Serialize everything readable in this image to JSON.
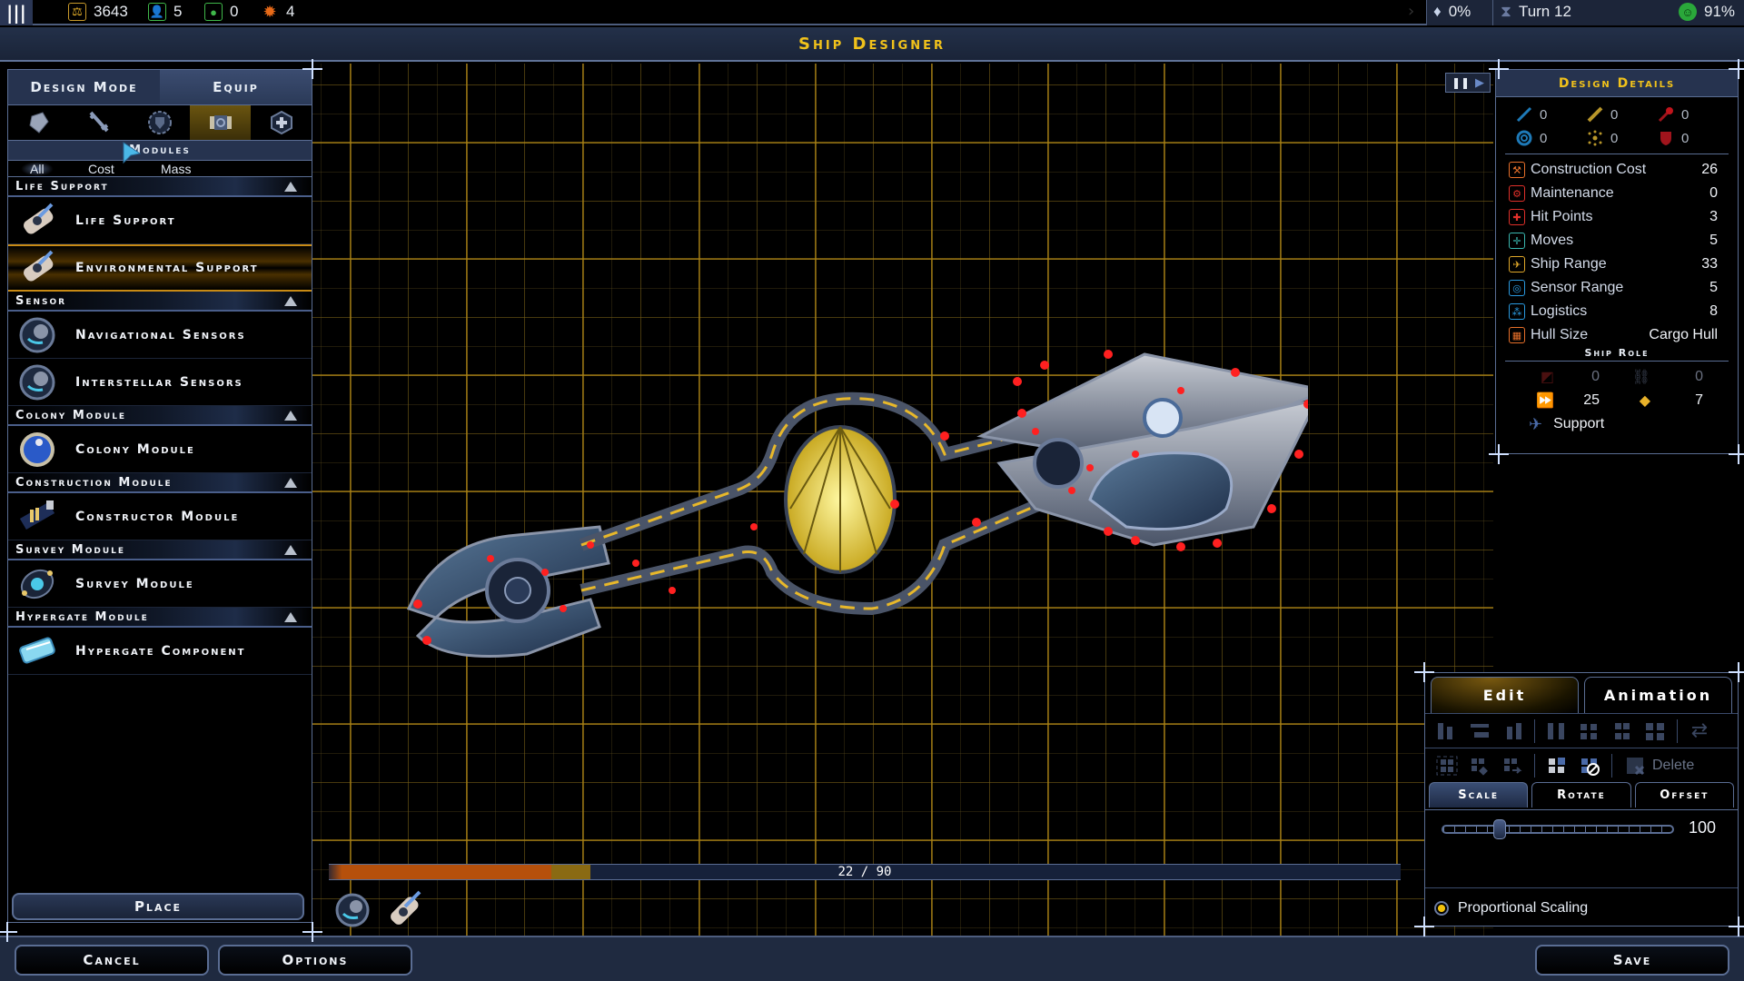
{
  "topbar": {
    "resources": [
      {
        "icon": "credits-icon",
        "value": "3643",
        "color": "#e8b22a"
      },
      {
        "icon": "population-icon",
        "value": "5",
        "color": "#3fb84a"
      },
      {
        "icon": "food-icon",
        "value": "0",
        "color": "#3fb84a"
      },
      {
        "icon": "production-icon",
        "value": "4",
        "color": "#e86a18"
      }
    ],
    "influence": "0%",
    "turn": "Turn 12",
    "approval": "91%"
  },
  "title": "Ship Designer",
  "left_panel": {
    "mode_tabs": [
      "Design Mode",
      "Equip"
    ],
    "category_icons": [
      "defense-icon",
      "weapon-icon",
      "shield-icon",
      "module-icon",
      "repair-icon"
    ],
    "selected_category": 3,
    "section_title": "Modules",
    "sort_options": [
      "All",
      "Cost",
      "Mass"
    ],
    "selected_sort": "All",
    "groups": [
      {
        "title": "Life Support",
        "items": [
          "Life Support",
          "Environmental Support"
        ]
      },
      {
        "title": "Sensor",
        "items": [
          "Navigational Sensors",
          "Interstellar Sensors"
        ]
      },
      {
        "title": "Colony Module",
        "items": [
          "Colony Module"
        ]
      },
      {
        "title": "Construction Module",
        "items": [
          "Constructor Module"
        ]
      },
      {
        "title": "Survey Module",
        "items": [
          "Survey Module"
        ]
      },
      {
        "title": "Hypergate Module",
        "items": [
          "Hypergate Component"
        ]
      }
    ],
    "selected_item": "Environmental Support",
    "place_label": "Place"
  },
  "capacity": {
    "used": 22,
    "total": 90,
    "label": "22 / 90"
  },
  "design_details": {
    "title": "Design Details",
    "weapons": [
      {
        "icon": "beam-weapon-icon",
        "value": "0",
        "color": "#1e7ab8"
      },
      {
        "icon": "kinetic-weapon-icon",
        "value": "0",
        "color": "#b8962a"
      },
      {
        "icon": "missile-weapon-icon",
        "value": "0",
        "color": "#a0141c"
      },
      {
        "icon": "shield-defense-icon",
        "value": "0",
        "color": "#1e7ab8"
      },
      {
        "icon": "point-defense-icon",
        "value": "0",
        "color": "#b8962a"
      },
      {
        "icon": "armor-defense-icon",
        "value": "0",
        "color": "#a0141c"
      }
    ],
    "stats": [
      {
        "icon": "construction-cost-icon",
        "name": "Construction Cost",
        "value": "26",
        "color": "#e8702a"
      },
      {
        "icon": "maintenance-icon",
        "name": "Maintenance",
        "value": "0",
        "color": "#e0302a"
      },
      {
        "icon": "hit-points-icon",
        "name": "Hit Points",
        "value": "3",
        "color": "#e0302a"
      },
      {
        "icon": "moves-icon",
        "name": "Moves",
        "value": "5",
        "color": "#3ab8b0"
      },
      {
        "icon": "ship-range-icon",
        "name": "Ship Range",
        "value": "33",
        "color": "#e0a82a"
      },
      {
        "icon": "sensor-range-icon",
        "name": "Sensor Range",
        "value": "5",
        "color": "#2a9ae0"
      },
      {
        "icon": "logistics-icon",
        "name": "Logistics",
        "value": "8",
        "color": "#2a9ae0"
      },
      {
        "icon": "hull-size-icon",
        "name": "Hull Size",
        "value": "Cargo Hull",
        "color": "#e8702a"
      }
    ],
    "ship_role_title": "Ship Role",
    "role_stats": [
      {
        "icon": "attack-role-icon",
        "value": "0",
        "dim": true
      },
      {
        "icon": "link-role-icon",
        "value": "0",
        "dim": true
      },
      {
        "icon": "speed-role-icon",
        "value": "25",
        "dim": false
      },
      {
        "icon": "gem-role-icon",
        "value": "7",
        "dim": false
      }
    ],
    "role": "Support"
  },
  "edit_panel": {
    "tabs": [
      "Edit",
      "Animation"
    ],
    "selected_tab": "Edit",
    "delete_label": "Delete",
    "sub_tabs": [
      "Scale",
      "Rotate",
      "Offset"
    ],
    "selected_sub_tab": "Scale",
    "scale_value": "100",
    "scale_slider_fraction": 0.25,
    "proportional_scaling_label": "Proportional Scaling",
    "proportional_scaling_on": true
  },
  "footer": {
    "cancel": "Cancel",
    "options": "Options",
    "save": "Save"
  }
}
